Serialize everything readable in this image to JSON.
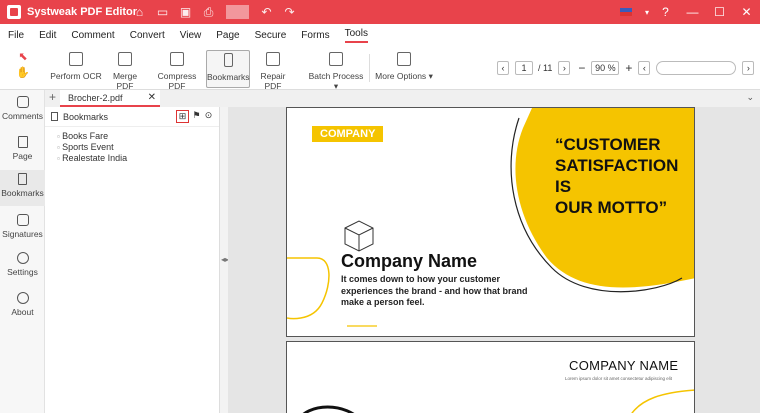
{
  "app": {
    "title": "Systweak PDF Editor"
  },
  "menu": [
    "File",
    "Edit",
    "Comment",
    "Convert",
    "View",
    "Page",
    "Secure",
    "Forms",
    "Tools"
  ],
  "toolbar": {
    "tools": [
      "Perform OCR",
      "Merge PDF",
      "Compress PDF",
      "Bookmarks",
      "Repair PDF",
      "Batch Process",
      "More Options"
    ],
    "page_current": "1",
    "page_total": "/ 11",
    "zoom": "90 %"
  },
  "sidebar": {
    "items": [
      "Comments",
      "Page",
      "Bookmarks",
      "Signatures",
      "Settings",
      "About"
    ]
  },
  "tab": {
    "filename": "Brocher-2.pdf"
  },
  "bookmarks": {
    "header": "Bookmarks",
    "items": [
      "Books Fare",
      "Sports Event",
      "Realestate India"
    ]
  },
  "document": {
    "badge": "COMPANY",
    "slogan_l1": "“CUSTOMER",
    "slogan_l2": "SATISFACTION IS",
    "slogan_l3": "OUR MOTTO”",
    "company_name": "Company Name",
    "tagline_l1": "It comes down to how your customer",
    "tagline_l2": "experiences the brand - and how that brand",
    "tagline_l3": "make a person feel.",
    "page2_title": "COMPANY NAME",
    "page2_sub": "Lorem ipsum dolor sit amet consectetur adipiscing elit"
  },
  "colors": {
    "accent": "#e8434b",
    "brand_yellow": "#f5c400"
  }
}
